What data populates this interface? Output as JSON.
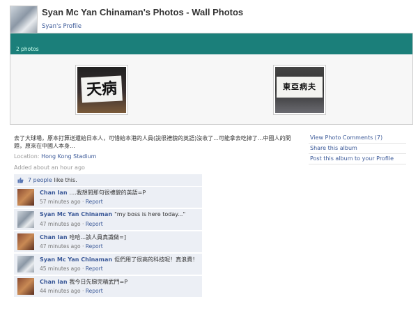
{
  "header": {
    "title": "Syan Mc Yan Chinaman's Photos - Wall Photos",
    "profile_link": "Syan's Profile"
  },
  "album": {
    "photo_count": "2 photos",
    "photos": [
      {
        "sign_text": "天病"
      },
      {
        "sign_text": "東亞病夫"
      }
    ]
  },
  "photo": {
    "caption": "去了大球場，原本打算送還給日本人，可惜給本港的人員(說很禮貌的英語)沒收了...可能拿去吃掉了...中國人的問題，原來在中國人本身...",
    "location_label": "Location:",
    "location_value": "Hong Kong Stadium",
    "added": "Added about an hour ago"
  },
  "side_actions": {
    "view_comments": "View Photo Comments (7)",
    "share": "Share this album",
    "post_to_profile": "Post this album to your Profile"
  },
  "likes": {
    "link": "7 people",
    "text": " like this."
  },
  "comments": [
    {
      "author": "Chan Ian",
      "text": "....我想問那句很禮貌的英語=P",
      "time": "57 minutes ago",
      "report": "Report"
    },
    {
      "author": "Syan Mc Yan Chinaman",
      "text": "\"my boss is here today...\"",
      "time": "47 minutes ago",
      "report": "Report"
    },
    {
      "author": "Chan Ian",
      "text": "哈哈...該人員真識做=]",
      "time": "47 minutes ago",
      "report": "Report"
    },
    {
      "author": "Syan Mc Yan Chinaman",
      "text": "佢們用了很高的科技呢！真浪費！",
      "time": "45 minutes ago",
      "report": "Report"
    },
    {
      "author": "Chan Ian",
      "text": "我今日先睇完精武門=P",
      "time": "44 minutes ago",
      "report": "Report"
    }
  ],
  "separator": " · ",
  "colors": {
    "link": "#3b5998",
    "album_bar": "#1b7f7a",
    "comment_bg": "#eceff5"
  }
}
